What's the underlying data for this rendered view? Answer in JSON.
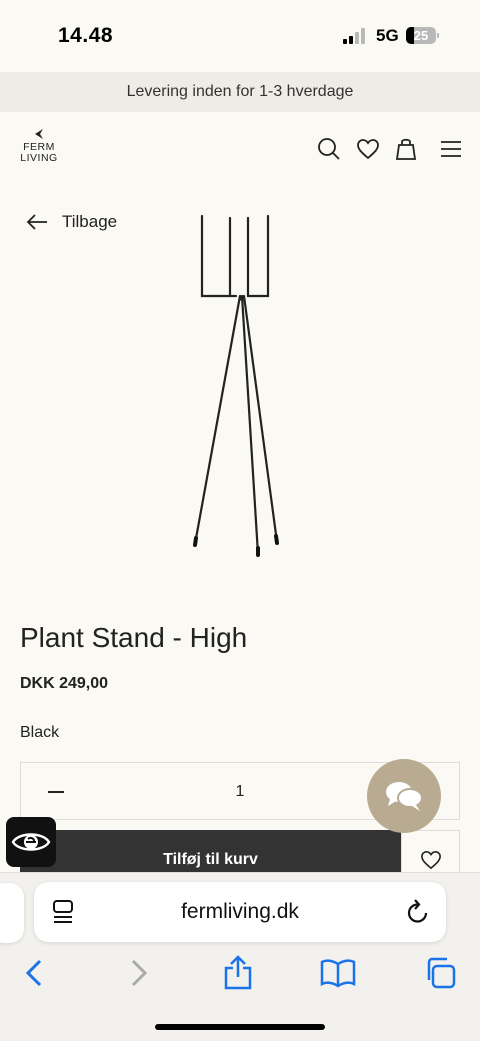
{
  "status_bar": {
    "time": "14.48",
    "network": "5G",
    "battery": "25",
    "battery_level": 0.25
  },
  "promo_banner": {
    "text": "Levering inden for 1-3 hverdage"
  },
  "header": {
    "logo_line1": "FERM",
    "logo_line2": "LIVING",
    "icons": [
      "search-icon",
      "heart-icon",
      "bag-icon",
      "menu-icon"
    ]
  },
  "back_link": {
    "label": "Tilbage"
  },
  "product": {
    "title": "Plant Stand - High",
    "price": "DKK 249,00",
    "color": "Black",
    "quantity": "1",
    "add_to_cart": "Tilføj til kurv"
  },
  "browser": {
    "url": "fermliving.dk"
  },
  "colors": {
    "background": "#faf9f4",
    "banner": "#eeece5",
    "cart_button": "#333333",
    "chat_bubble": "#b9ab92",
    "browser_accent": "#1a73e8"
  }
}
